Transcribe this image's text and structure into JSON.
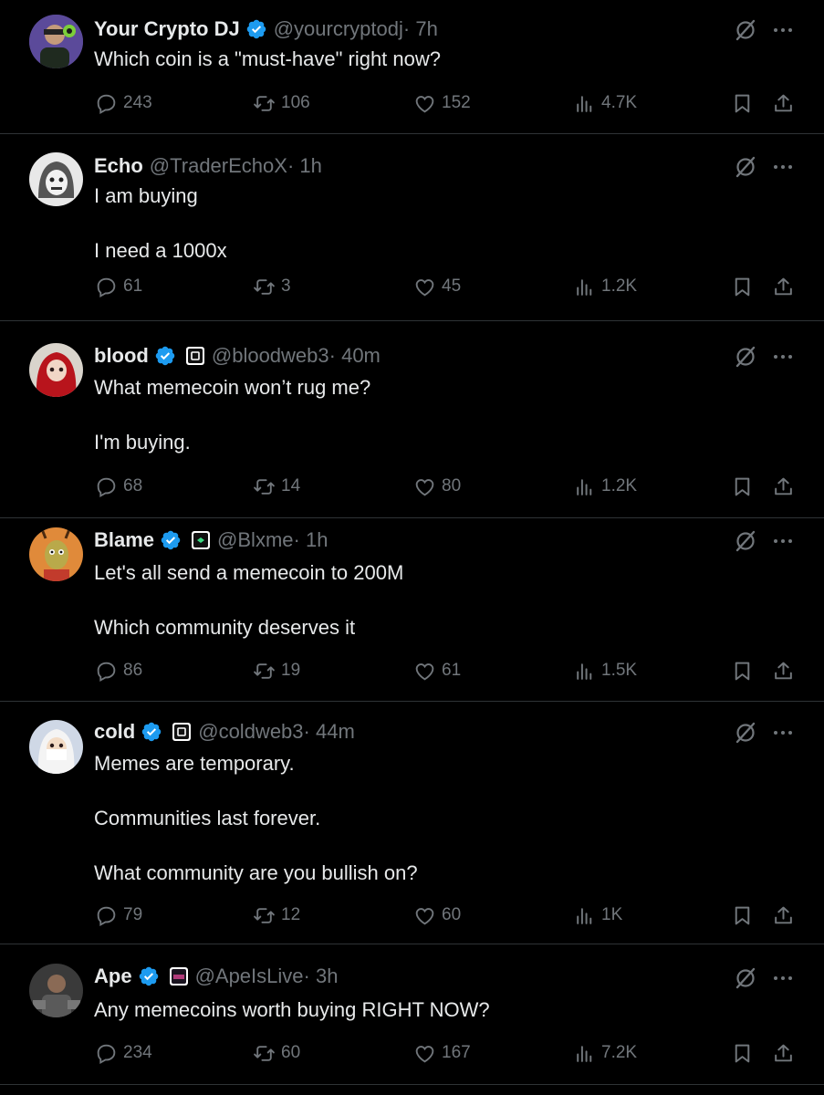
{
  "colors": {
    "background": "#000000",
    "text": "#e7e9ea",
    "muted": "#71767b",
    "verified": "#1d9bf0",
    "divider": "#2f3336"
  },
  "tweets": [
    {
      "name": "Your Crypto DJ",
      "verified": true,
      "affiliate_badge": false,
      "handle": "@yourcryptodj",
      "time": " · 7h",
      "text": "Which coin is a \"must-have\" right now?",
      "replies": "243",
      "retweets": "106",
      "likes": "152",
      "views": "4.7K"
    },
    {
      "name": "Echo",
      "verified": false,
      "affiliate_badge": false,
      "handle": "@TraderEchoX",
      "time": " · 1h",
      "text": "I am buying\n\nI need a 1000x",
      "replies": "61",
      "retweets": "3",
      "likes": "45",
      "views": "1.2K"
    },
    {
      "name": "blood",
      "verified": true,
      "affiliate_badge": true,
      "handle": "@bloodweb3",
      "time": " · 40m",
      "text": "What memecoin won’t rug me?\n\nI'm buying.",
      "replies": "68",
      "retweets": "14",
      "likes": "80",
      "views": "1.2K"
    },
    {
      "name": "Blame",
      "verified": true,
      "affiliate_badge": true,
      "handle": "@Blxme",
      "time": " · 1h",
      "text": "Let's all send a memecoin to 200M\n\nWhich community deserves it",
      "replies": "86",
      "retweets": "19",
      "likes": "61",
      "views": "1.5K"
    },
    {
      "name": "cold",
      "verified": true,
      "affiliate_badge": true,
      "handle": "@coldweb3",
      "time": " · 44m",
      "text": "Memes are temporary.\n\nCommunities last forever.\n\nWhat community are you bullish on?",
      "replies": "79",
      "retweets": "12",
      "likes": "60",
      "views": "1K"
    },
    {
      "name": "Ape",
      "verified": true,
      "affiliate_badge": true,
      "handle": "@ApeIsLive",
      "time": " · 3h",
      "text": "Any memecoins worth buying RIGHT NOW?",
      "replies": "234",
      "retweets": "60",
      "likes": "167",
      "views": "7.2K"
    }
  ],
  "icons": {
    "reply": "reply-icon",
    "retweet": "retweet-icon",
    "like": "heart-icon",
    "views": "views-icon",
    "bookmark": "bookmark-icon",
    "share": "share-icon",
    "grok": "grok-icon",
    "more": "more-icon",
    "verified": "verified-badge-icon"
  }
}
